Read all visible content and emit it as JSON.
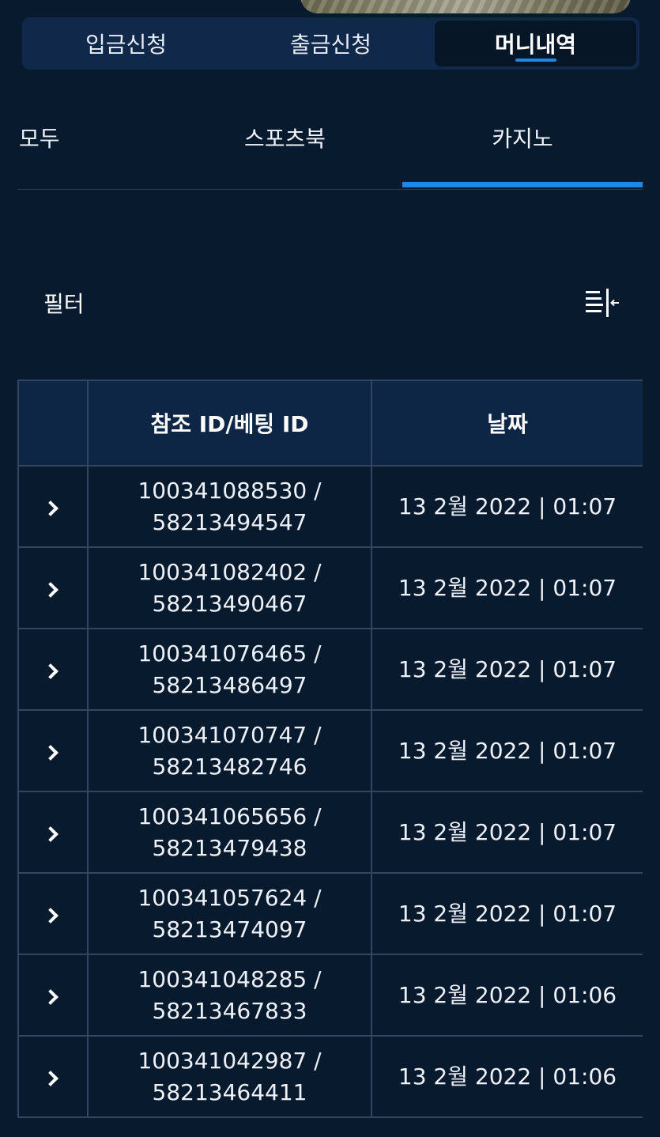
{
  "main_tabs": [
    {
      "label": "입금신청",
      "active": false
    },
    {
      "label": "출금신청",
      "active": false
    },
    {
      "label": "머니내역",
      "active": true
    }
  ],
  "sub_tabs": [
    {
      "label": "모두",
      "active": false
    },
    {
      "label": "스포츠북",
      "active": false
    },
    {
      "label": "카지노",
      "active": true
    }
  ],
  "filter": {
    "label": "필터",
    "icon": "filter-collapse-icon"
  },
  "table": {
    "headers": [
      "",
      "참조 ID/베팅 ID",
      "날짜"
    ],
    "rows": [
      {
        "ref_id": "100341088530 /",
        "bet_id": "58213494547",
        "date": "13 2월 2022 | 01:07"
      },
      {
        "ref_id": "100341082402 /",
        "bet_id": "58213490467",
        "date": "13 2월 2022 | 01:07"
      },
      {
        "ref_id": "100341076465 /",
        "bet_id": "58213486497",
        "date": "13 2월 2022 | 01:07"
      },
      {
        "ref_id": "100341070747 /",
        "bet_id": "58213482746",
        "date": "13 2월 2022 | 01:07"
      },
      {
        "ref_id": "100341065656 /",
        "bet_id": "58213479438",
        "date": "13 2월 2022 | 01:07"
      },
      {
        "ref_id": "100341057624 /",
        "bet_id": "58213474097",
        "date": "13 2월 2022 | 01:07"
      },
      {
        "ref_id": "100341048285 /",
        "bet_id": "58213467833",
        "date": "13 2월 2022 | 01:06"
      },
      {
        "ref_id": "100341042987 /",
        "bet_id": "58213464411",
        "date": "13 2월 2022 | 01:06"
      }
    ]
  },
  "colors": {
    "background": "#081a2e",
    "accent": "#1e88e5",
    "header_bg": "#0d2646",
    "tab_bar_bg": "#10294a"
  }
}
